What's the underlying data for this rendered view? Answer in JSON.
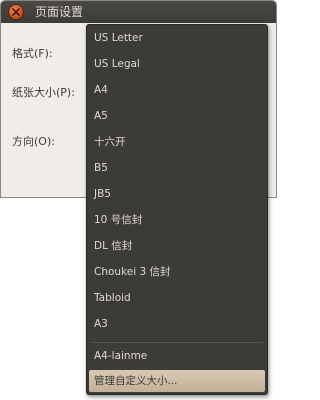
{
  "window": {
    "title": "页面设置"
  },
  "form": {
    "format_label": "格式(F):",
    "paper_size_label": "纸张大小(P):",
    "orientation_label": "方向(O):"
  },
  "paper_menu": {
    "items": [
      "US Letter",
      "US Legal",
      "A4",
      "A5",
      "十六开",
      "B5",
      "JB5",
      "10 号信封",
      "DL 信封",
      "Choukei 3 信封",
      "Tabloid",
      "A3",
      "A4-lainme"
    ],
    "manage_custom": "管理自定义大小..."
  },
  "colors": {
    "menu_bg": "#3c3b37",
    "menu_text": "#dfdbd2",
    "highlight": "#c9b9a2",
    "close_button": "#dd4814"
  }
}
